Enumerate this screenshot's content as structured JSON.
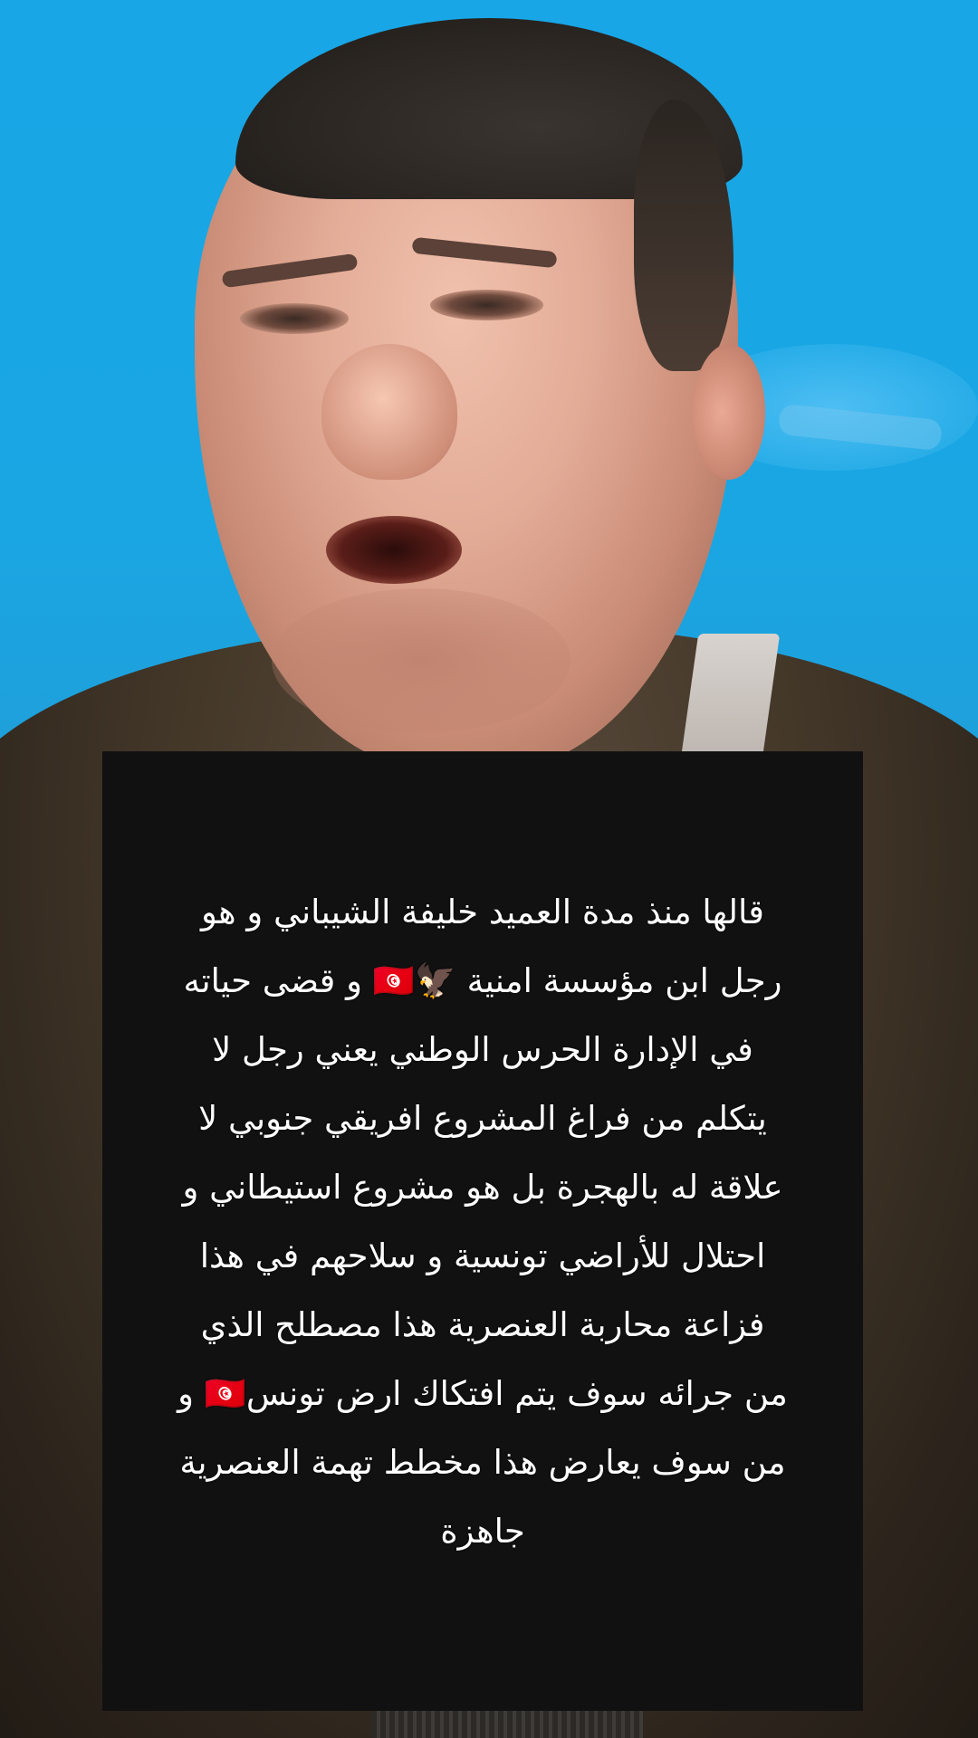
{
  "scene": {
    "background_color": "#18a6e6",
    "subject": "man-speaking"
  },
  "caption": {
    "text": "قالها منذ مدة العميد خليفة الشيباني و هو\nرجل ابن مؤسسة امنية 🦅🇹🇳 و قضى حياته\nفي الإدارة الحرس الوطني يعني رجل لا\nيتكلم من فراغ المشروع افريقي جنوبي لا\nعلاقة له بالهجرة بل هو مشروع استيطاني و\nاحتلال للأراضي تونسية و سلاحهم في هذا\nفزاعة محاربة العنصرية هذا مصطلح الذي\nمن جرائه سوف يتم افتكاك ارض تونس🇹🇳 و\nمن سوف يعارض هذا مخطط تهمة العنصرية\nجاهزة",
    "panel_color": "#111111",
    "text_color": "#ffffff"
  }
}
